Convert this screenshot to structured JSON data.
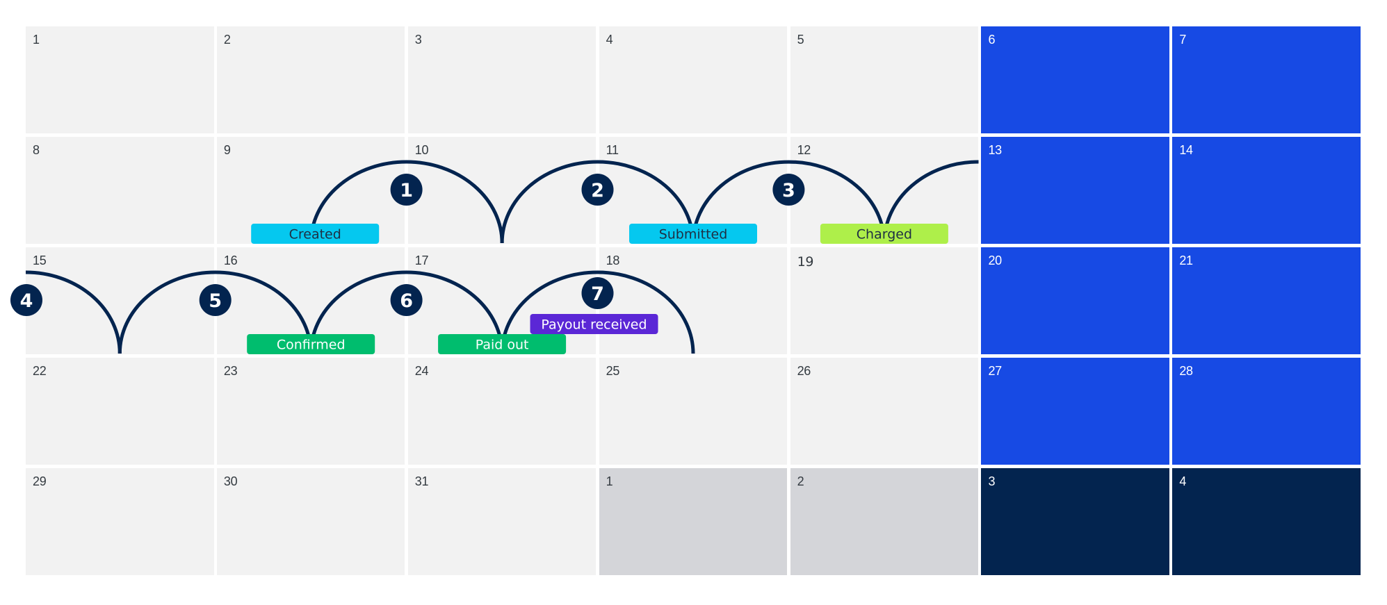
{
  "calendar": {
    "weeks": [
      [
        {
          "day": "1",
          "type": "normal"
        },
        {
          "day": "2",
          "type": "normal"
        },
        {
          "day": "3",
          "type": "normal"
        },
        {
          "day": "4",
          "type": "normal"
        },
        {
          "day": "5",
          "type": "normal"
        },
        {
          "day": "6",
          "type": "weekend"
        },
        {
          "day": "7",
          "type": "weekend"
        }
      ],
      [
        {
          "day": "8",
          "type": "normal"
        },
        {
          "day": "9",
          "type": "normal"
        },
        {
          "day": "10",
          "type": "normal"
        },
        {
          "day": "11",
          "type": "normal"
        },
        {
          "day": "12",
          "type": "normal"
        },
        {
          "day": "13",
          "type": "weekend"
        },
        {
          "day": "14",
          "type": "weekend"
        }
      ],
      [
        {
          "day": "15",
          "type": "normal"
        },
        {
          "day": "16",
          "type": "normal"
        },
        {
          "day": "17",
          "type": "normal"
        },
        {
          "day": "18",
          "type": "normal"
        },
        {
          "day": "19",
          "type": "normal"
        },
        {
          "day": "20",
          "type": "weekend"
        },
        {
          "day": "21",
          "type": "weekend"
        }
      ],
      [
        {
          "day": "22",
          "type": "normal"
        },
        {
          "day": "23",
          "type": "normal"
        },
        {
          "day": "24",
          "type": "normal"
        },
        {
          "day": "25",
          "type": "normal"
        },
        {
          "day": "26",
          "type": "normal"
        },
        {
          "day": "27",
          "type": "weekend"
        },
        {
          "day": "28",
          "type": "weekend"
        }
      ],
      [
        {
          "day": "29",
          "type": "normal"
        },
        {
          "day": "30",
          "type": "normal"
        },
        {
          "day": "31",
          "type": "normal"
        },
        {
          "day": "1",
          "type": "next-month"
        },
        {
          "day": "2",
          "type": "next-month"
        },
        {
          "day": "3",
          "type": "next-weekend"
        },
        {
          "day": "4",
          "type": "next-weekend"
        }
      ]
    ]
  },
  "colors": {
    "cell": "#f2f2f2",
    "weekend": "#174ae4",
    "next_month": "#d4d5d9",
    "next_weekend": "#03244f",
    "arc": "#03244f",
    "step_badge": "#03244f"
  },
  "timeline": {
    "steps": [
      "1",
      "2",
      "3",
      "4",
      "5",
      "6",
      "7"
    ],
    "events": [
      {
        "label": "Created",
        "week": 1,
        "weekday": 1,
        "bg": "#05c8ef",
        "fg": "#1e2f44"
      },
      {
        "label": "Submitted",
        "week": 1,
        "weekday": 3,
        "bg": "#05c8ef",
        "fg": "#1e2f44"
      },
      {
        "label": "Charged",
        "week": 1,
        "weekday": 4,
        "bg": "#aeef4a",
        "fg": "#1e2f44"
      },
      {
        "label": "Confirmed",
        "week": 2,
        "weekday": 1,
        "bg": "#00bd6e",
        "fg": "#ffffff"
      },
      {
        "label": "Paid out",
        "week": 2,
        "weekday": 2,
        "bg": "#00bd6e",
        "fg": "#ffffff"
      },
      {
        "label": "Payout received",
        "week": 2,
        "weekday": 3,
        "bg": "#5b27d6",
        "fg": "#ffffff"
      }
    ]
  }
}
